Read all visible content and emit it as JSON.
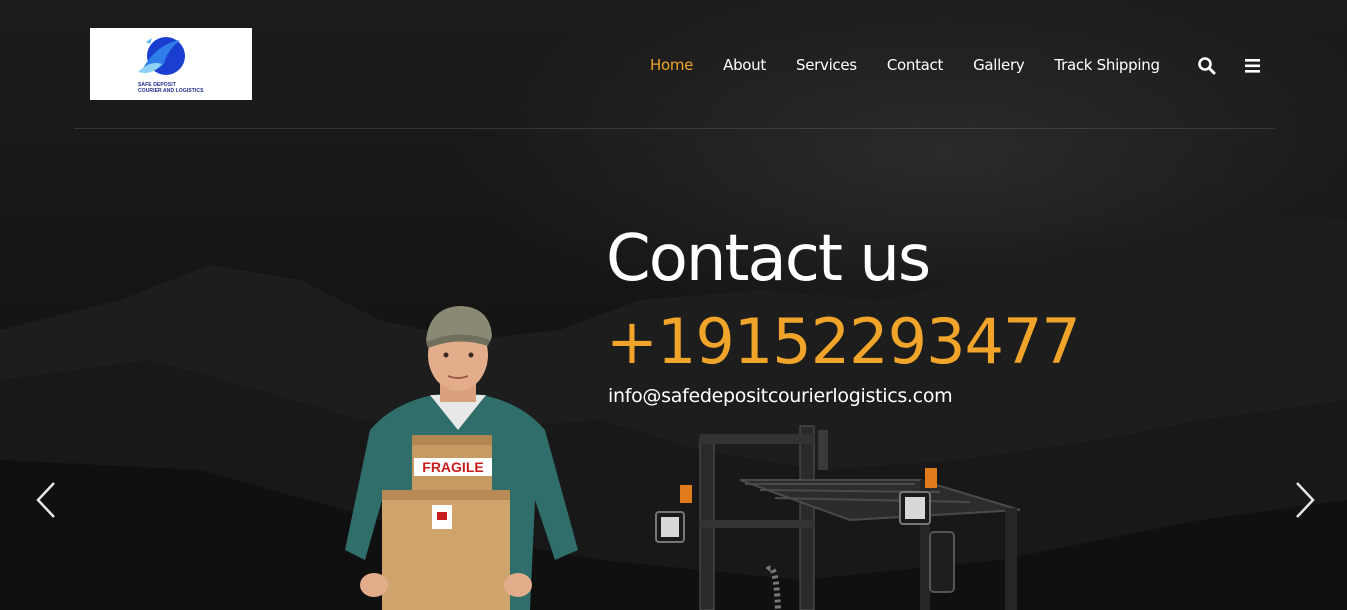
{
  "logo": {
    "line1": "SAFE DEPOSIT",
    "line2": "COURIER AND LOGISTICS"
  },
  "nav": {
    "items": [
      {
        "label": "Home",
        "active": true
      },
      {
        "label": "About",
        "active": false
      },
      {
        "label": "Services",
        "active": false
      },
      {
        "label": "Contact",
        "active": false
      },
      {
        "label": "Gallery",
        "active": false
      },
      {
        "label": "Track Shipping",
        "active": false
      }
    ],
    "icons": [
      "search-icon",
      "menu-icon"
    ]
  },
  "hero": {
    "title": "Contact us",
    "phone": "+19152293477",
    "email": "info@safedepositcourierlogistics.com",
    "box_label": "FRAGILE"
  },
  "slider": {
    "prev_icon": "chevron-left-icon",
    "next_icon": "chevron-right-icon"
  },
  "colors": {
    "accent": "#f0a52a",
    "background": "#141414",
    "text": "#ffffff"
  }
}
